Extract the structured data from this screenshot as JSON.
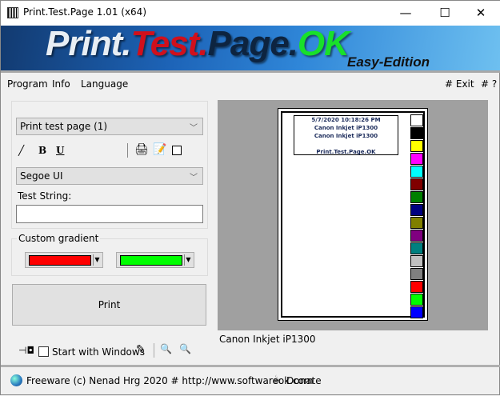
{
  "window": {
    "title": "Print.Test.Page 1.01  (x64)",
    "minimize": "—",
    "maximize": "☐",
    "close": "✕"
  },
  "banner": {
    "logo_parts": [
      "Print.",
      "Test.",
      "Page.",
      "OK"
    ],
    "logo_colors": [
      "#e8eef4",
      "#d0101c",
      "#0d2440",
      "#18e02a"
    ],
    "edition": "Easy-Edition"
  },
  "menu": {
    "items": [
      "Program",
      "Info",
      "Language"
    ],
    "exit": "# Exit",
    "help": "# ?"
  },
  "controls": {
    "page_select": "Print test page (1)",
    "font_select": "Segoe UI",
    "test_string_label": "Test String:",
    "test_string_value": "",
    "bold": "B",
    "underline": "U",
    "gradient_label": "Custom gradient",
    "gradient_colors": [
      "#ff0000",
      "#00ff00"
    ],
    "print_label": "Print",
    "start_with_windows": "Start with Windows",
    "start_with_windows_checked": false
  },
  "preview": {
    "lines": [
      "5/7/2020 10:18:26 PM",
      "Canon Inkjet iP1300",
      "Canon Inkjet iP1300",
      "",
      "Print.Test.Page.OK"
    ],
    "swatches": [
      "#ffffff",
      "#000000",
      "#ffff00",
      "#ff00ff",
      "#00ffff",
      "#800000",
      "#008000",
      "#000080",
      "#808000",
      "#800080",
      "#008080",
      "#c0c0c0",
      "#808080",
      "#ff0000",
      "#00ff00",
      "#0000ff"
    ],
    "printer_name": "Canon Inkjet iP1300"
  },
  "status": {
    "text": "Freeware (c) Nenad Hrg 2020 # http://www.softwareok.com",
    "donate": "Donate"
  }
}
